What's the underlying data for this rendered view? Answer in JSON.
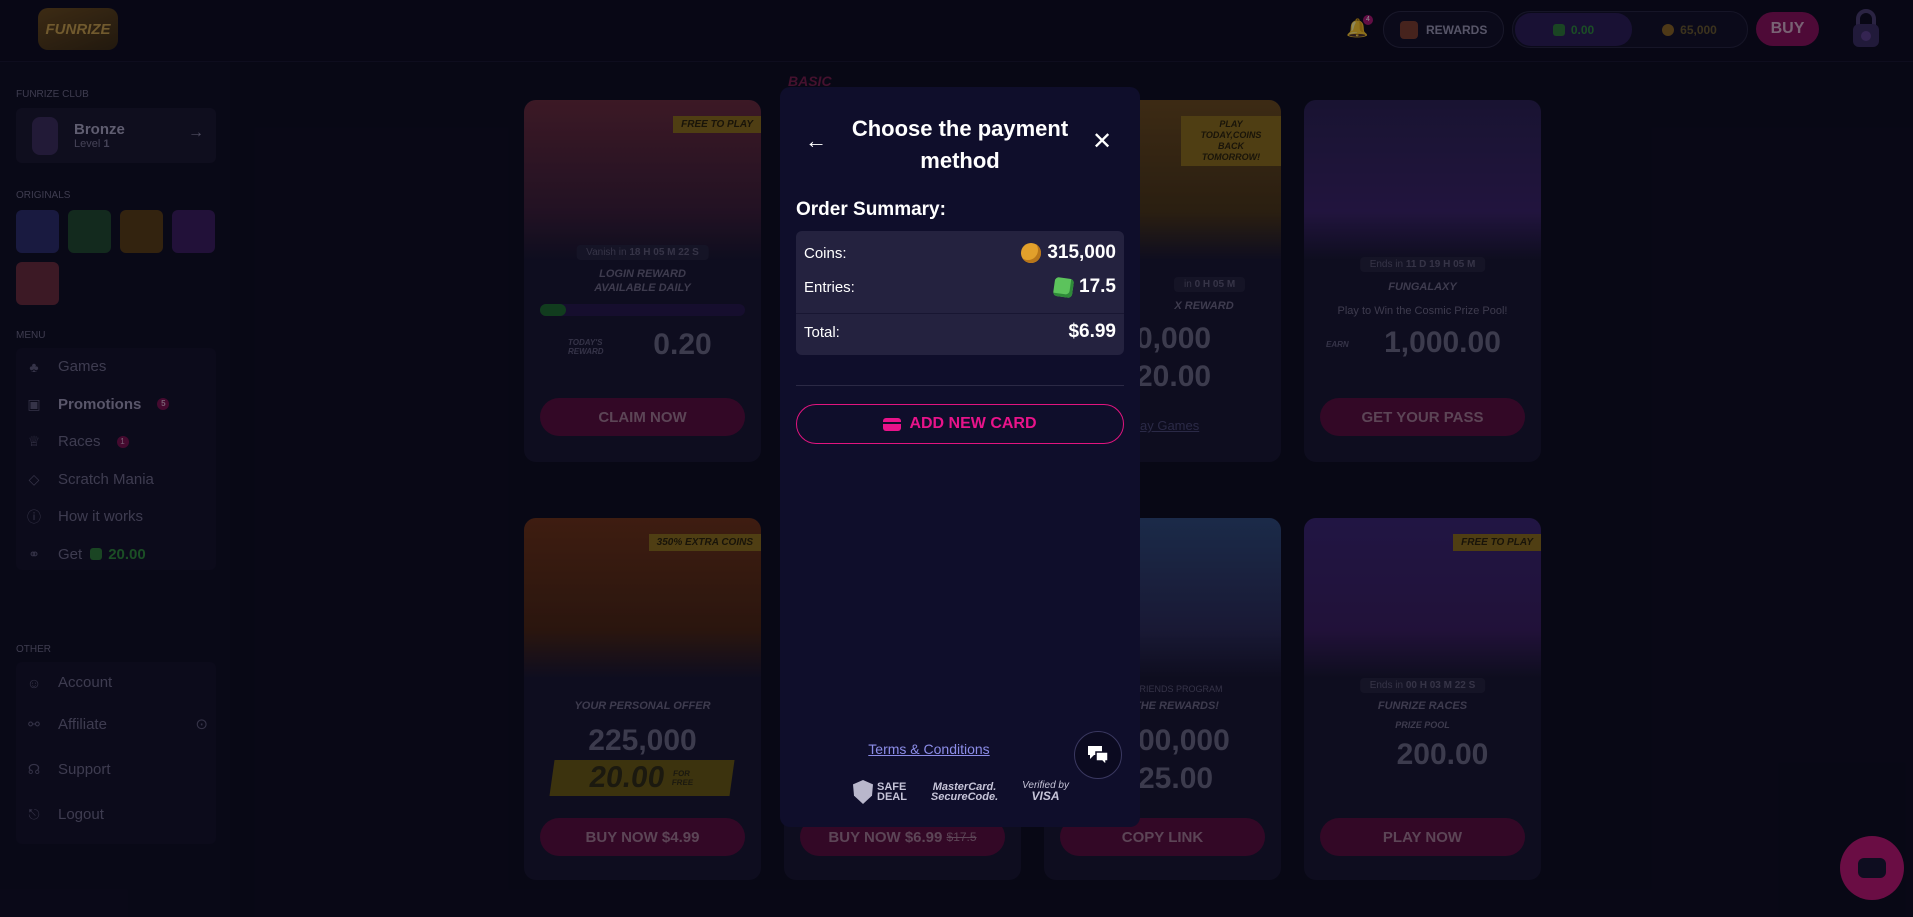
{
  "header": {
    "logo_text": "FUNRIZE",
    "notification_count": "4",
    "rewards_label": "REWARDS",
    "entries_balance": "0.00",
    "coins_balance": "65,000",
    "buy_label": "BUY"
  },
  "sidebar": {
    "club_section": "FUNRIZE CLUB",
    "club_name": "Bronze",
    "club_level_label": "Level",
    "club_level_value": "1",
    "originals_section": "ORIGINALS",
    "menu_section": "MENU",
    "menu": [
      {
        "label": "Games",
        "icon": "games-icon"
      },
      {
        "label": "Promotions",
        "icon": "gift-icon",
        "badge": "5"
      },
      {
        "label": "Races",
        "icon": "trophy-icon",
        "badge": "1"
      },
      {
        "label": "Scratch Mania",
        "icon": "ticket-icon"
      },
      {
        "label": "How it works",
        "icon": "info-icon"
      },
      {
        "label": "Get",
        "icon": "referral-icon",
        "amount": "20.00"
      }
    ],
    "other_section": "OTHER",
    "other": [
      {
        "label": "Account",
        "icon": "user-icon"
      },
      {
        "label": "Affiliate",
        "icon": "handshake-icon"
      },
      {
        "label": "Support",
        "icon": "support-icon"
      },
      {
        "label": "Logout",
        "icon": "logout-icon"
      }
    ]
  },
  "cards": {
    "login": {
      "ribbon": "FREE TO PLAY",
      "timer_prefix": "Vanish in",
      "timer": "18 H 05 M 22 S",
      "title1": "LOGIN REWARD",
      "title2": "AVAILABLE DAILY",
      "today_label": "TODAY'S REWARD",
      "amount": "0.20",
      "button": "CLAIM NOW"
    },
    "basic": {
      "ribbon": "BASIC",
      "button": "BUY NOW $6.99",
      "old_price": "$17.5"
    },
    "play_today": {
      "ribbon": "PLAY TODAY,COINS BACK TOMORROW!",
      "timer_prefix": "in",
      "timer": "0 H 05 M",
      "title": "X REWARD",
      "line1": "0,000",
      "line2": "20.00",
      "link": "ay Games"
    },
    "fungalaxy": {
      "timer_prefix": "Ends in",
      "timer": "11 D 19 H 05 M",
      "title": "FUNGALAXY",
      "subtitle": "Play to Win the Cosmic Prize Pool!",
      "earn_label": "EARN",
      "amount": "1,000.00",
      "button": "GET YOUR PASS"
    },
    "personal": {
      "ribbon": "350% EXTRA COINS",
      "title": "YOUR PERSONAL OFFER",
      "coins": "225,000",
      "entries": "20.00",
      "for_free": "FOR FREE",
      "button": "BUY NOW $4.99"
    },
    "friends": {
      "label": "FRIENDS PROGRAM",
      "title": "THE REWARDS!",
      "line1": "00,000",
      "line2": "25.00",
      "button": "COPY LINK"
    },
    "races": {
      "ribbon": "FREE TO PLAY",
      "timer_prefix": "Ends in",
      "timer": "00 H 03 M 22 S",
      "title": "FUNRIZE RACES",
      "subtitle": "PRIZE POOL",
      "amount": "200.00",
      "button": "PLAY NOW"
    }
  },
  "modal": {
    "title": "Choose the payment method",
    "summary_title": "Order Summary:",
    "coins_label": "Coins:",
    "coins_value": "315,000",
    "entries_label": "Entries:",
    "entries_value": "17.5",
    "total_label": "Total:",
    "total_value": "$6.99",
    "add_card_label": "ADD NEW CARD",
    "terms_label": "Terms & Conditions",
    "badges": {
      "safe_line1": "SAFE",
      "safe_line2": "DEAL",
      "mc_line1": "MasterCard.",
      "mc_line2": "SecureCode.",
      "visa_line1": "Verified by",
      "visa_line2": "VISA"
    }
  },
  "colors": {
    "accent": "#e8138a",
    "modal_bg": "#0f0e2b",
    "summary_bg": "#24223f",
    "page_bg": "#0c0b1d"
  }
}
